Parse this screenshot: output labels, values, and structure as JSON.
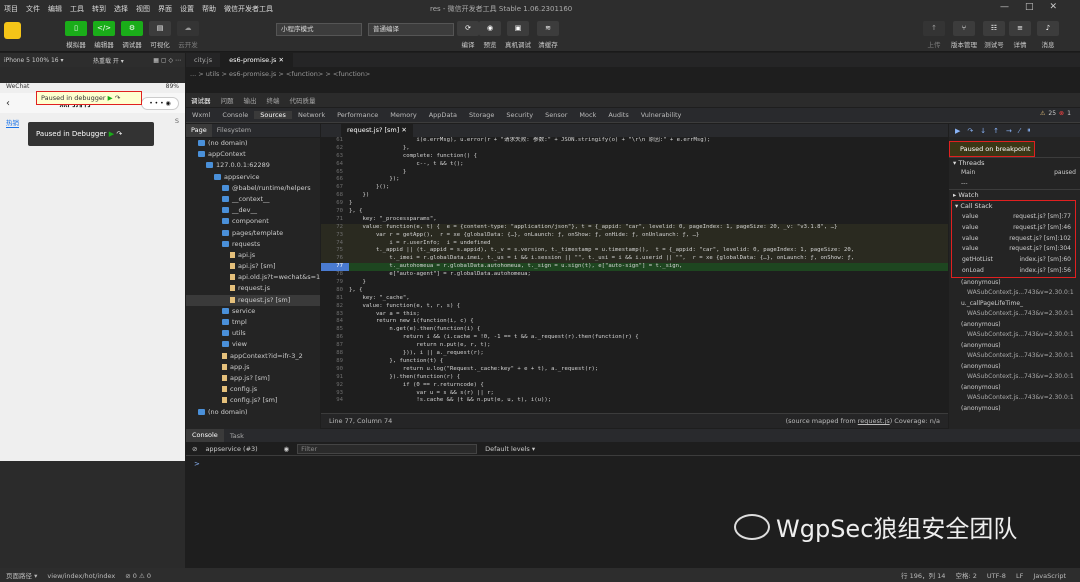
{
  "menu": [
    "项目",
    "文件",
    "编辑",
    "工具",
    "转到",
    "选择",
    "视图",
    "界面",
    "设置",
    "帮助",
    "微信开发者工具"
  ],
  "title": "res - 微信开发者工具 Stable 1.06.2301160",
  "toolbar": {
    "buttons": [
      "模拟器",
      "编辑器",
      "调试器",
      "可视化",
      "云开发"
    ],
    "mode": "小程序模式",
    "compile": "普通编译",
    "actions": [
      "编译",
      "预览",
      "真机调试",
      "清缓存"
    ],
    "right": [
      "上传",
      "版本管理",
      "测试号",
      "详情",
      "消息"
    ]
  },
  "sim": {
    "device": "iPhone 5 100% 16 ▾",
    "hot": "热重载 开 ▾",
    "wechat": "WeChat",
    "battery": "89%",
    "page_title": "热门排行",
    "paused_small": "Paused in debugger",
    "paused_big": "Paused in Debugger",
    "tab_hot": "热销",
    "tab_s": "S"
  },
  "editor_tabs": [
    "city.js",
    "es6-promise.js"
  ],
  "breadcrumb": "... > utils > es6-promise.js > <function> > <function>",
  "dt_tabs": [
    "调试器",
    "问题",
    "输出",
    "终端",
    "代码质量"
  ],
  "dev_tabs": [
    "Wxml",
    "Console",
    "Sources",
    "Network",
    "Performance",
    "Memory",
    "AppData",
    "Storage",
    "Security",
    "Sensor",
    "Mock",
    "Audits",
    "Vulnerability"
  ],
  "badge": {
    "warn": "25",
    "err": "1"
  },
  "sub_tabs": [
    "Page",
    "Filesystem"
  ],
  "file_tab": "request.js? [sm]",
  "tree": [
    {
      "d": 1,
      "t": "f",
      "l": "(no domain)"
    },
    {
      "d": 1,
      "t": "f",
      "l": "appContext"
    },
    {
      "d": 2,
      "t": "f",
      "l": "127.0.0.1:62289"
    },
    {
      "d": 3,
      "t": "f",
      "l": "appservice"
    },
    {
      "d": 4,
      "t": "f",
      "l": "@babel/runtime/helpers"
    },
    {
      "d": 4,
      "t": "f",
      "l": "__context__"
    },
    {
      "d": 4,
      "t": "f",
      "l": "__dev__"
    },
    {
      "d": 4,
      "t": "f",
      "l": "component"
    },
    {
      "d": 4,
      "t": "f",
      "l": "pages/template"
    },
    {
      "d": 4,
      "t": "f",
      "l": "requests"
    },
    {
      "d": 5,
      "t": "j",
      "l": "api.js"
    },
    {
      "d": 5,
      "t": "j",
      "l": "api.js? [sm]"
    },
    {
      "d": 5,
      "t": "j",
      "l": "api.old.js?t=wechat&s=1"
    },
    {
      "d": 5,
      "t": "j",
      "l": "request.js"
    },
    {
      "d": 5,
      "t": "j",
      "l": "request.js? [sm]"
    },
    {
      "d": 4,
      "t": "f",
      "l": "service"
    },
    {
      "d": 4,
      "t": "f",
      "l": "tmpl"
    },
    {
      "d": 4,
      "t": "f",
      "l": "utils"
    },
    {
      "d": 4,
      "t": "f",
      "l": "view"
    },
    {
      "d": 4,
      "t": "j",
      "l": "appContext?id=ifr-3_2"
    },
    {
      "d": 4,
      "t": "j",
      "l": "app.js"
    },
    {
      "d": 4,
      "t": "j",
      "l": "app.js? [sm]"
    },
    {
      "d": 4,
      "t": "j",
      "l": "config.js"
    },
    {
      "d": 4,
      "t": "j",
      "l": "config.js? [sm]"
    },
    {
      "d": 1,
      "t": "f",
      "l": "(no domain)"
    }
  ],
  "code": [
    {
      "n": "61",
      "t": "                    i(e.errMsg), u.error(r + \"请求失败: 参数:\" + JSON.stringify(o) + \"\\r\\n 原因:\" + e.errMsg);"
    },
    {
      "n": "62",
      "t": "                },"
    },
    {
      "n": "63",
      "t": "                complete: function() {"
    },
    {
      "n": "64",
      "t": "                    c--, t && t();"
    },
    {
      "n": "65",
      "t": "                }"
    },
    {
      "n": "66",
      "t": "            });"
    },
    {
      "n": "67",
      "t": "        }();"
    },
    {
      "n": "68",
      "t": "    })"
    },
    {
      "n": "69",
      "t": "}"
    },
    {
      "n": "70",
      "t": "}, {"
    },
    {
      "n": "71",
      "t": "    key: \"_processparams\","
    },
    {
      "n": "72",
      "t": "    value: function(e, t) {  e = {content-type: \"application/json\"}, t = {_appid: \"car\", levelid: 0, pageIndex: 1, pageSize: 20, _v: \"v3.1.8\", …}"
    },
    {
      "n": "73",
      "t": "        var r = getApp(),  r = xe {globalData: {…}, onLaunch: ƒ, onShow: ƒ, onHide: ƒ, onUnlaunch: ƒ, …}"
    },
    {
      "n": "74",
      "t": "            i = r.userInfo;  i = undefined"
    },
    {
      "n": "75",
      "t": "        t._appid || (t._appid = s.appid), t._v = s.version, t._timestamp = u.timestamp(),  t = {_appid: \"car\", levelid: 0, pageIndex: 1, pageSize: 20,"
    },
    {
      "n": "76",
      "t": "            t._imei = r.globalData.imei, t._us = i && i.session || \"\", t._usi = i && i.userid || \"\",  r = xe {globalData: {…}, onLaunch: ƒ, onShow: ƒ,"
    },
    {
      "n": "77",
      "t": "            t._autohomeua = r.globalData.autohomeua, t._sign = u.sign(t), e[\"auto-sign\"] = t._sign,"
    },
    {
      "n": "78",
      "t": "            e[\"auto-agent\"] = r.globalData.autohomeua;"
    },
    {
      "n": "79",
      "t": "    }"
    },
    {
      "n": "80",
      "t": "}, {"
    },
    {
      "n": "81",
      "t": "    key: \"_cache\","
    },
    {
      "n": "82",
      "t": "    value: function(e, t, r, s) {"
    },
    {
      "n": "83",
      "t": "        var a = this;"
    },
    {
      "n": "84",
      "t": "        return new i(function(i, c) {"
    },
    {
      "n": "85",
      "t": "            n.get(e).then(function(i) {"
    },
    {
      "n": "86",
      "t": "                return i && (i.cache = !0, -1 == t && a._request(r).then(function(r) {"
    },
    {
      "n": "87",
      "t": "                    return n.put(e, r, t);"
    },
    {
      "n": "88",
      "t": "                })), i || a._request(r);"
    },
    {
      "n": "89",
      "t": "            }, function(t) {"
    },
    {
      "n": "90",
      "t": "                return u.log(\"Request._cache:key\" + e + t), a._request(r);"
    },
    {
      "n": "91",
      "t": "            }).then(function(r) {"
    },
    {
      "n": "92",
      "t": "                if (0 == r.returncode) {"
    },
    {
      "n": "93",
      "t": "                    var u = s && s(r) || r;"
    },
    {
      "n": "94",
      "t": "                    !s.cache && (t && n.put(e, u, t), i(u));"
    }
  ],
  "code_status": {
    "pos": "Line 77, Column 74",
    "mapped_pre": "(source mapped from ",
    "mapped_link": "request.js",
    "mapped_post": ") Coverage: n/a"
  },
  "right": {
    "paused": "Paused on breakpoint",
    "threads": "Threads",
    "main": "Main",
    "main_state": "paused",
    "dots": "---",
    "watch": "Watch",
    "callstack": "Call Stack",
    "stack": [
      {
        "f": "value",
        "l": "request.js? [sm]:77"
      },
      {
        "f": "value",
        "l": "request.js? [sm]:46"
      },
      {
        "f": "value",
        "l": "request.js? [sm]:102"
      },
      {
        "f": "value",
        "l": "request.js? [sm]:304"
      },
      {
        "f": "getHotList",
        "l": "index.js? [sm]:60"
      },
      {
        "f": "onLoad",
        "l": "index.js? [sm]:56"
      }
    ],
    "anon": [
      {
        "f": "(anonymous)",
        "l": "WASubContext.js...743&v=2.30.0:1"
      },
      {
        "f": "u._callPageLifeTime_",
        "l": "WASubContext.js...743&v=2.30.0:1"
      },
      {
        "f": "(anonymous)",
        "l": "WASubContext.js...743&v=2.30.0:1"
      },
      {
        "f": "(anonymous)",
        "l": "WASubContext.js...743&v=2.30.0:1"
      },
      {
        "f": "(anonymous)",
        "l": "WASubContext.js...743&v=2.30.0:1"
      },
      {
        "f": "(anonymous)",
        "l": "WASubContext.js...743&v=2.30.0:1"
      },
      {
        "f": "(anonymous)",
        "l": ""
      }
    ]
  },
  "console": {
    "tabs": [
      "Console",
      "Task"
    ],
    "context": "appservice (#3)",
    "filter": "Filter",
    "levels": "Default levels ▾",
    "prompt": ">"
  },
  "watermark": "WgpSec狼组安全团队",
  "status": {
    "path": "页面路径 ▾",
    "page": "view/index/hot/index",
    "err": "⊘ 0 ⚠ 0",
    "pos": "行 196，列 14",
    "spaces": "空格: 2",
    "enc": "UTF-8",
    "eol": "LF",
    "lang": "JavaScript"
  },
  "colors": {
    "accent": "#1aad19",
    "highlight": "#e02020",
    "exec_line": "#1e4620"
  }
}
